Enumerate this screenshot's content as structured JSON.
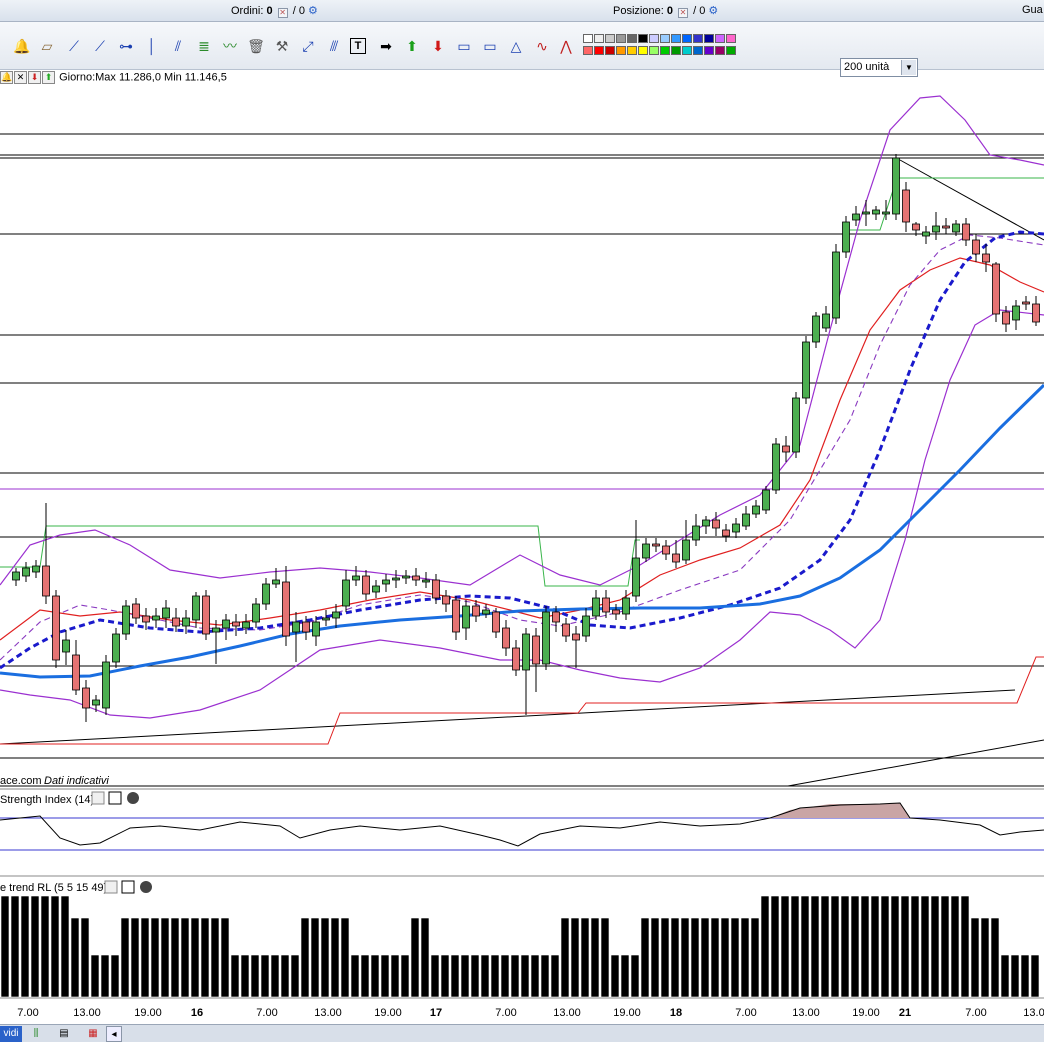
{
  "status_bar": {
    "orders_label": "Ordini:",
    "orders_value": "0",
    "orders_total": "/ 0",
    "position_label": "Posizione:",
    "position_value": "0",
    "position_total": "/ 0",
    "right_label": "Gua"
  },
  "toolbar": {
    "unit_select_value": "200 unità"
  },
  "chart": {
    "header_text": "Giorno:Max 11.286,0 Min 11.146,5",
    "source_text": "ace.com",
    "disclaimer_text": "Dati indicativi",
    "rsi_title": "Strength Index (14)",
    "trend_title": "e trend RL (5 5 15 49)",
    "x_labels": [
      "7.00",
      "13.00",
      "19.00",
      "16",
      "7.00",
      "13.00",
      "19.00",
      "17",
      "7.00",
      "13.00",
      "19.00",
      "18",
      "7.00",
      "13.00",
      "19.00",
      "21",
      "7.00",
      "13.0"
    ],
    "colors": {
      "bull_candle": "#4caf50",
      "bear_candle": "#e57373",
      "ma_blue": "#1a6ee0",
      "ma_dash": "#1a1acc",
      "bollinger": "#9b30d0",
      "red_line": "#e02020",
      "green_line": "#39b54a"
    }
  },
  "bottom": {
    "tab_label": "vidi"
  }
}
